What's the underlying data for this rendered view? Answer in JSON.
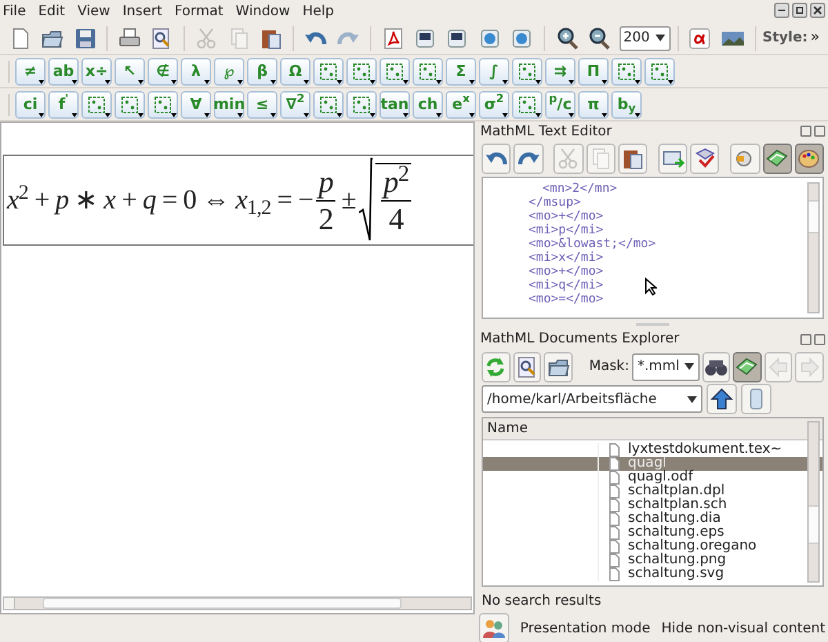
{
  "menu": [
    "File",
    "Edit",
    "View",
    "Insert",
    "Format",
    "Window",
    "Help"
  ],
  "main_toolbar": [
    {
      "kind": "button",
      "disabled": false
    },
    {
      "kind": "button",
      "disabled": false
    },
    {
      "kind": "button",
      "disabled": false
    },
    {
      "kind": "separator"
    },
    {
      "kind": "button",
      "disabled": false
    },
    {
      "kind": "button",
      "disabled": false
    },
    {
      "kind": "separator"
    },
    {
      "kind": "button",
      "disabled": true
    },
    {
      "kind": "button",
      "disabled": true
    },
    {
      "kind": "button",
      "disabled": false
    },
    {
      "kind": "separator"
    },
    {
      "kind": "button",
      "disabled": false
    },
    {
      "kind": "button",
      "disabled": true
    },
    {
      "kind": "separator"
    },
    {
      "kind": "button",
      "disabled": false
    },
    {
      "kind": "button",
      "disabled": false
    },
    {
      "kind": "button",
      "disabled": false
    },
    {
      "kind": "button",
      "disabled": false
    },
    {
      "kind": "button",
      "disabled": false
    },
    {
      "kind": "separator"
    },
    {
      "kind": "button",
      "disabled": false
    },
    {
      "kind": "button",
      "disabled": false
    },
    {
      "kind": "zoom",
      "value": "200"
    },
    {
      "kind": "separator"
    },
    {
      "kind": "button",
      "disabled": false
    },
    {
      "kind": "button",
      "disabled": false
    },
    {
      "kind": "separator"
    },
    {
      "kind": "label",
      "text": "Style:"
    },
    {
      "kind": "more",
      "text": "»"
    }
  ],
  "palette_rows": [
    [
      {
        "kind": "glyph",
        "text": "≠"
      },
      {
        "kind": "glyph",
        "text": "ab"
      },
      {
        "kind": "glyph",
        "text": "x÷"
      },
      {
        "kind": "glyph",
        "text": "↖"
      },
      {
        "kind": "glyph",
        "text": "∉"
      },
      {
        "kind": "glyph",
        "text": "λ"
      },
      {
        "kind": "glyph",
        "text": "℘"
      },
      {
        "kind": "glyph",
        "text": "β"
      },
      {
        "kind": "glyph",
        "text": "Ω"
      },
      {
        "kind": "icon"
      },
      {
        "kind": "icon"
      },
      {
        "kind": "icon"
      },
      {
        "kind": "icon"
      },
      {
        "kind": "glyph",
        "text": "Σ"
      },
      {
        "kind": "glyph",
        "text": "∫"
      },
      {
        "kind": "icon"
      },
      {
        "kind": "glyph",
        "text": "⇉"
      },
      {
        "kind": "glyph",
        "text": "Π"
      },
      {
        "kind": "icon"
      },
      {
        "kind": "icon"
      }
    ],
    [
      {
        "kind": "glyph",
        "text": "ci"
      },
      {
        "kind": "glyph",
        "text": "f$^{'}$"
      },
      {
        "kind": "icon"
      },
      {
        "kind": "icon"
      },
      {
        "kind": "icon"
      },
      {
        "kind": "glyph",
        "text": "∀"
      },
      {
        "kind": "glyph",
        "text": "min"
      },
      {
        "kind": "glyph",
        "text": "≤"
      },
      {
        "kind": "glyph",
        "text": "∇$^{2}$"
      },
      {
        "kind": "icon"
      },
      {
        "kind": "icon"
      },
      {
        "kind": "glyph",
        "text": "tan"
      },
      {
        "kind": "glyph",
        "text": "ch"
      },
      {
        "kind": "glyph",
        "text": "e$^{x}$"
      },
      {
        "kind": "glyph",
        "text": "σ$^{2}$"
      },
      {
        "kind": "icon"
      },
      {
        "kind": "glyph",
        "text": "$^{p}$/c"
      },
      {
        "kind": "glyph",
        "text": "π"
      },
      {
        "kind": "glyph",
        "text": "b$_{y}$"
      }
    ]
  ],
  "formula": {
    "lhs": "*x*$^{2}$ + *p* ∗ *x* + *q* = 0 ⇔ *x*$_{1,2}$ = −",
    "fraction": {
      "numerator": "*p*",
      "denominator": "2"
    },
    "pm": "±",
    "root_fraction": {
      "numerator": "*p*$^{2}$",
      "denominator": "4"
    }
  },
  "text_editor": {
    "title": "MathML Text Editor",
    "toolbar": [
      {
        "disabled": false,
        "on": false
      },
      {
        "disabled": false,
        "on": false
      },
      {
        "disabled": true,
        "on": false
      },
      {
        "disabled": true,
        "on": false
      },
      {
        "disabled": false,
        "on": false
      },
      {
        "disabled": false,
        "on": false
      },
      {
        "disabled": false,
        "on": false
      },
      {
        "disabled": false,
        "on": false
      },
      {
        "disabled": false,
        "on": true
      },
      {
        "disabled": false,
        "on": true
      }
    ],
    "code_lines": [
      {
        "children": [
          {
            "text": "<mn>2</mn>"
          }
        ]
      },
      {
        "text": "</msup>"
      },
      {
        "text": "<mo>+</mo>"
      },
      {
        "text": "<mi>p</mi>"
      },
      {
        "text": "<mo>&lowast;</mo>"
      },
      {
        "text": "<mi>x</mi>"
      },
      {
        "text": "<mo>+</mo>"
      },
      {
        "text": "<mi>q</mi>"
      },
      {
        "text": "<mo>=</mo>"
      }
    ]
  },
  "explorer": {
    "title": "MathML Documents Explorer",
    "buttons": [
      {
        "disabled": false,
        "on": false
      },
      {
        "disabled": false,
        "on": false
      },
      {
        "disabled": false,
        "on": false
      },
      {
        "disabled": false,
        "on": false
      },
      {
        "disabled": false,
        "on": true
      },
      {
        "disabled": true,
        "on": false
      },
      {
        "disabled": true,
        "on": false
      }
    ],
    "mask_label": "Mask:",
    "mask": "*.mml",
    "path": "/home/karl/Arbeitsfläche",
    "column": "Name",
    "files": [
      {
        "name": "lyxtestdokument.tex~",
        "selected": false
      },
      {
        "name": "quagl",
        "selected": true
      },
      {
        "name": "quagl.odf",
        "selected": false
      },
      {
        "name": "schaltplan.dpl",
        "selected": false
      },
      {
        "name": "schaltplan.sch",
        "selected": false
      },
      {
        "name": "schaltung.dia",
        "selected": false
      },
      {
        "name": "schaltung.eps",
        "selected": false
      },
      {
        "name": "schaltung.oregano",
        "selected": false
      },
      {
        "name": "schaltung.png",
        "selected": false
      },
      {
        "name": "schaltung.svg",
        "selected": false
      }
    ],
    "status": "No search results"
  },
  "status_bar": {
    "presentation": "Presentation mode",
    "hide": "Hide non-visual content"
  }
}
